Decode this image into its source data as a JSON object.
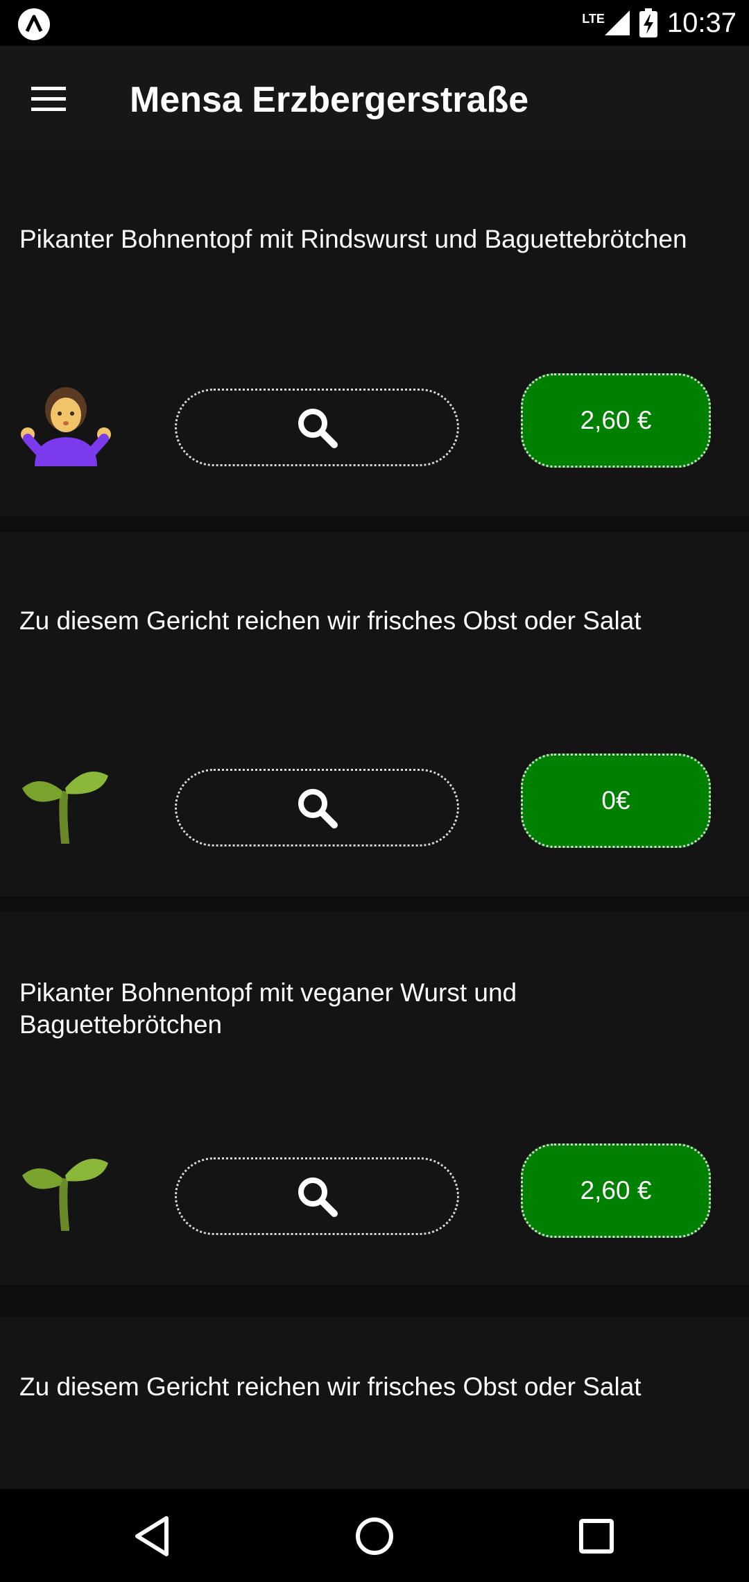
{
  "status_bar": {
    "network": "LTE",
    "time": "10:37"
  },
  "app_bar": {
    "title": "Mensa Erzbergerstraße"
  },
  "meals": [
    {
      "name": "Pikanter Bohnentopf mit Rindswurst und Baguettebrötchen",
      "icon": "person-shrugging-icon",
      "price": "2,60 €"
    },
    {
      "name": "Zu diesem Gericht reichen wir frisches Obst oder Salat",
      "icon": "seedling-icon",
      "price": "0€"
    },
    {
      "name": "Pikanter Bohnentopf mit veganer Wurst und Baguettebrötchen",
      "icon": "seedling-icon",
      "price": "2,60 €"
    },
    {
      "name": "Zu diesem Gericht reichen wir frisches Obst oder Salat"
    }
  ],
  "colors": {
    "price_button": "#008000",
    "app_bar": "#171717",
    "card": "#141414"
  }
}
